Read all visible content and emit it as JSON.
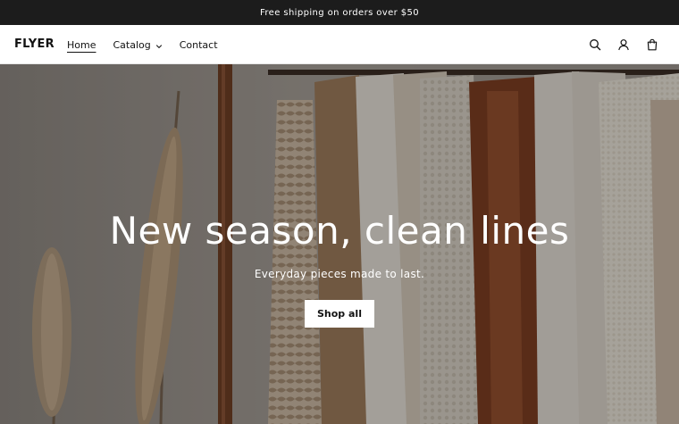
{
  "announcement": {
    "text": "Free shipping on orders over $50"
  },
  "header": {
    "logo": "FLYER",
    "nav": [
      {
        "label": "Home",
        "active": true
      },
      {
        "label": "Catalog",
        "has_dropdown": true
      },
      {
        "label": "Contact"
      }
    ],
    "icons": [
      "search-icon",
      "account-icon",
      "cart-icon"
    ]
  },
  "hero": {
    "title": "New season, clean lines",
    "subtitle": "Everyday pieces made to last.",
    "cta_label": "Shop all"
  },
  "colors": {
    "announcement_bg": "#1c1c1c",
    "header_bg": "#ffffff",
    "text": "#121212",
    "button_bg": "#ffffff"
  }
}
